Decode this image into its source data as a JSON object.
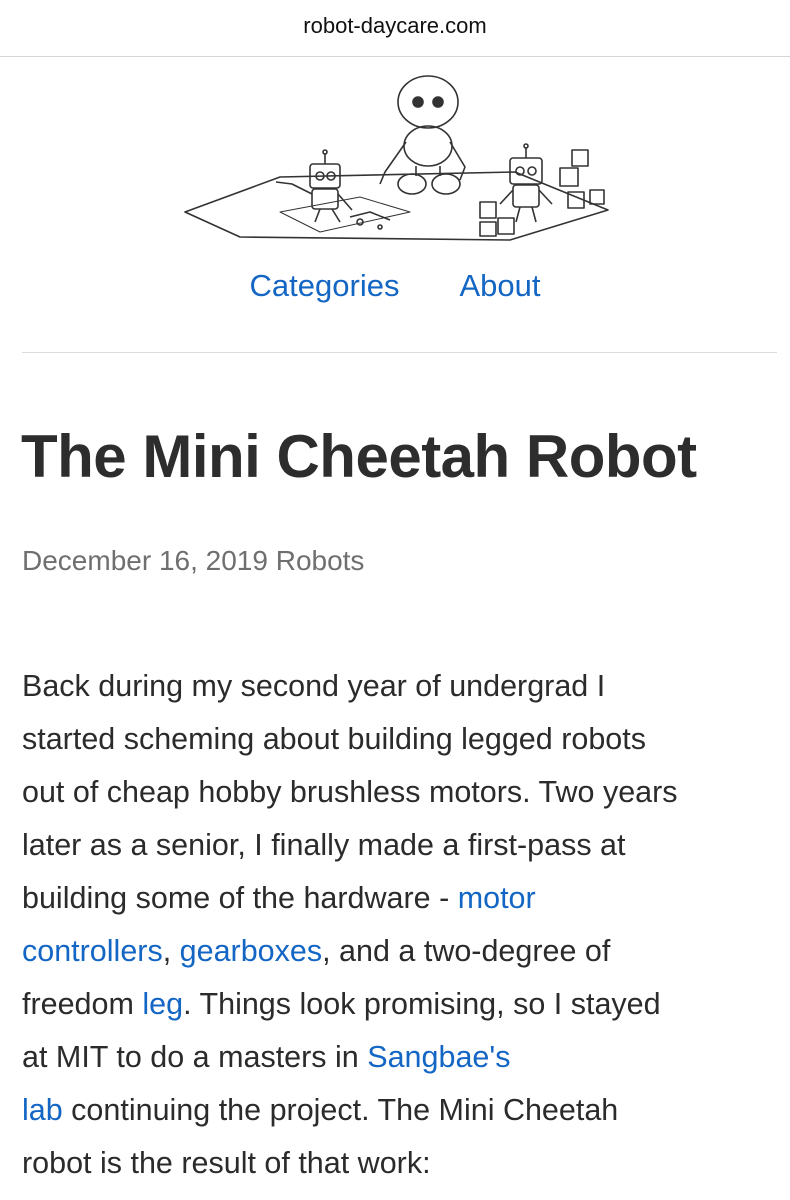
{
  "browser": {
    "url": "robot-daycare.com"
  },
  "header": {
    "illustration_icon": "robots-playing-illustration",
    "nav": {
      "categories": "Categories",
      "about": "About"
    }
  },
  "post": {
    "title": "The Mini Cheetah Robot",
    "date": "December 16, 2019",
    "category": "Robots",
    "body": {
      "l1": "Back during my second year of undergrad I",
      "l2": "started scheming about building legged robots",
      "l3": "out of cheap hobby brushless motors.  Two years",
      "l4": "later as a senior, I finally made a first-pass at",
      "l5_text": "building some of the hardware - ",
      "link_motor": "motor",
      "link_controllers": "controllers",
      "sep1": ", ",
      "link_gearboxes": "gearboxes",
      "l6_text": ", and a two-degree of",
      "l7_text1": "freedom ",
      "link_leg": "leg",
      "l7_text2": ".  Things look promising, so I stayed",
      "l8_text": "at MIT to do a masters in ",
      "link_sangbae": "Sangbae's",
      "link_lab": "lab",
      "l9_text": " continuing the project.  The Mini Cheetah",
      "l10": "robot is the result of that work:"
    }
  }
}
